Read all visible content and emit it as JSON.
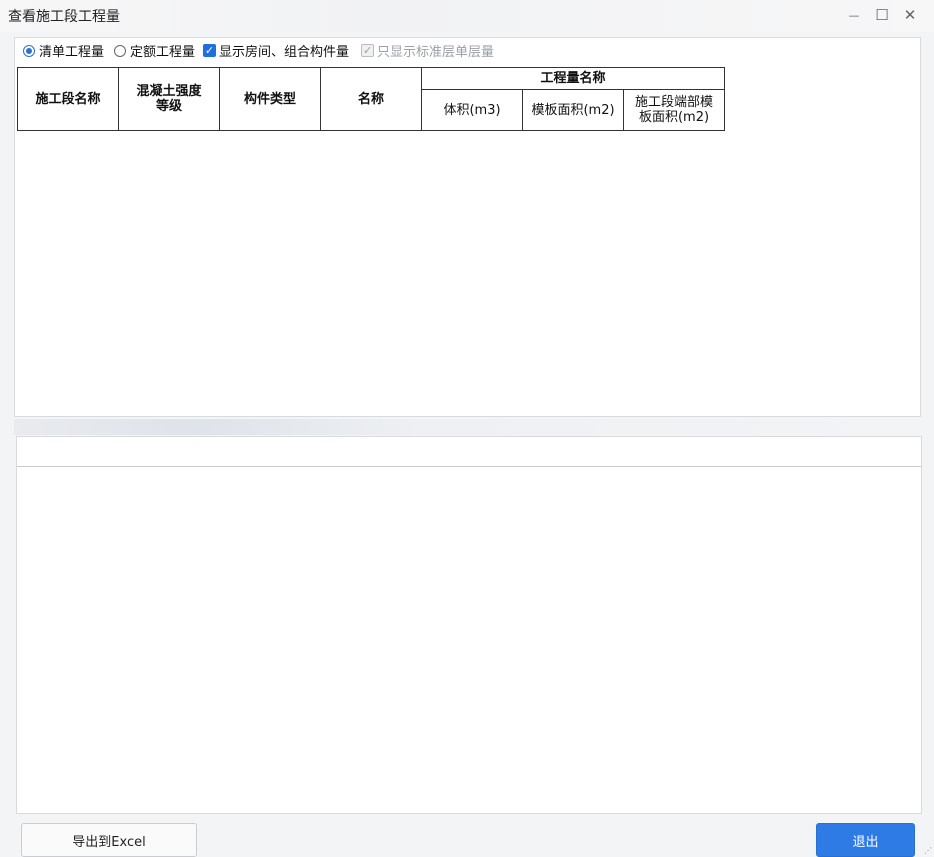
{
  "window": {
    "title": "查看施工段工程量",
    "minimize_glyph": "—",
    "maximize_glyph": "☐",
    "close_glyph": "✕"
  },
  "options": {
    "radio_bill": "清单工程量",
    "radio_quota": "定额工程量",
    "check_rooms": "显示房间、组合构件量",
    "check_standard": "只显示标准层单层量",
    "check_glyph": "✓"
  },
  "table": {
    "headers": {
      "segment_name": "施工段名称",
      "concrete_grade_line1": "混凝土强度",
      "concrete_grade_line2": "等级",
      "component_type": "构件类型",
      "name": "名称",
      "quantity_name": "工程量名称"
    },
    "sub_headers": {
      "volume": "体积(m3)",
      "formwork_area": "模板面积(m2)",
      "end_formwork_line1": "施工段端部模",
      "end_formwork_line2": "板面积(m2)"
    }
  },
  "footer": {
    "export_label": "导出到Excel",
    "exit_label": "退出"
  },
  "colors": {
    "accent": "#2f7be6"
  }
}
